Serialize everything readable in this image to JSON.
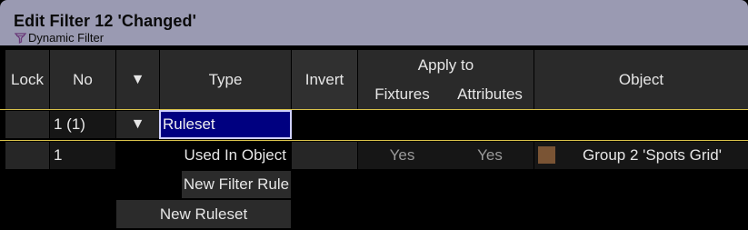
{
  "window": {
    "title": "Edit Filter 12 'Changed'",
    "subtitle": "Dynamic Filter",
    "subtitle_icon": "filter-icon"
  },
  "columns": {
    "lock": "Lock",
    "no": "No",
    "expand_icon": "▼",
    "type": "Type",
    "invert": "Invert",
    "apply_to": "Apply to",
    "fixtures": "Fixtures",
    "attributes": "Attributes",
    "object": "Object"
  },
  "ruleset_row": {
    "no": "1 (1)",
    "expand_icon": "▼",
    "type_value": "Ruleset"
  },
  "rule_row": {
    "no": "1",
    "type": "Used In Object",
    "fixtures": "Yes",
    "attributes": "Yes",
    "object_color": "#7a5434",
    "object": "Group 2 'Spots Grid'"
  },
  "buttons": {
    "new_filter_rule": "New Filter Rule",
    "new_ruleset": "New Ruleset"
  },
  "colors": {
    "title_bar": "#9a9ab2",
    "selection": "#000080",
    "selection_border": "#cfd0ff",
    "separator": "#d8c14a"
  }
}
